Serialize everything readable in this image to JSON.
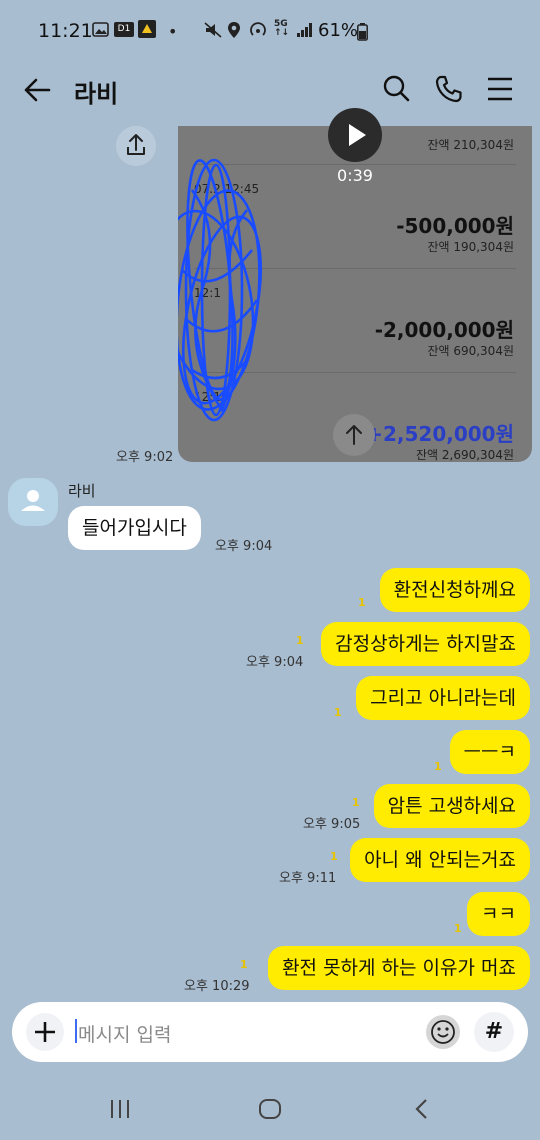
{
  "status_bar": {
    "time": "11:21",
    "d1_badge": "D1",
    "battery_pct": "61%",
    "network": "5G"
  },
  "header": {
    "title": "라비"
  },
  "media_message": {
    "duration": "0:39",
    "sent_time": "오후 9:02",
    "rows": [
      {
        "balance": "잔액 210,304원"
      },
      {
        "date": "07.2  12:45",
        "amount": "-500,000원",
        "balance": "잔액 190,304원"
      },
      {
        "date": "12:1",
        "amount": "-2,000,000원",
        "balance": "잔액 690,304원"
      },
      {
        "date": "12:16",
        "amount": "+2,520,000원",
        "balance": "잔액 2,690,304원"
      }
    ],
    "colors": {
      "deposit": "#2b3fc4",
      "scribble": "#1a4cff"
    }
  },
  "incoming": {
    "sender": "라비",
    "text": "들어가입시다",
    "time": "오후 9:04"
  },
  "outgoing": [
    {
      "text": "환전신청하께요",
      "unread": "1",
      "time": ""
    },
    {
      "text": "감정상하게는 하지말죠",
      "unread": "1",
      "time": "오후 9:04"
    },
    {
      "text": "그리고 아니라는데",
      "unread": "1",
      "time": ""
    },
    {
      "text": "ㅡㅡㅋ",
      "unread": "1",
      "time": ""
    },
    {
      "text": "암튼 고생하세요",
      "unread": "1",
      "time": "오후 9:05"
    },
    {
      "text": "아니 왜 안되는거죠",
      "unread": "1",
      "time": "오후 9:11"
    },
    {
      "text": "ㅋㅋ",
      "unread": "1",
      "time": ""
    },
    {
      "text": "환전 못하게 하는 이유가 머죠",
      "unread": "1",
      "time": "오후 10:29"
    }
  ],
  "input": {
    "placeholder": "메시지 입력",
    "hash": "#"
  },
  "colors": {
    "background": "#a9bdd0",
    "bubble_mine": "#ffec00",
    "bubble_theirs": "#ffffff",
    "unread": "#e6c300"
  }
}
